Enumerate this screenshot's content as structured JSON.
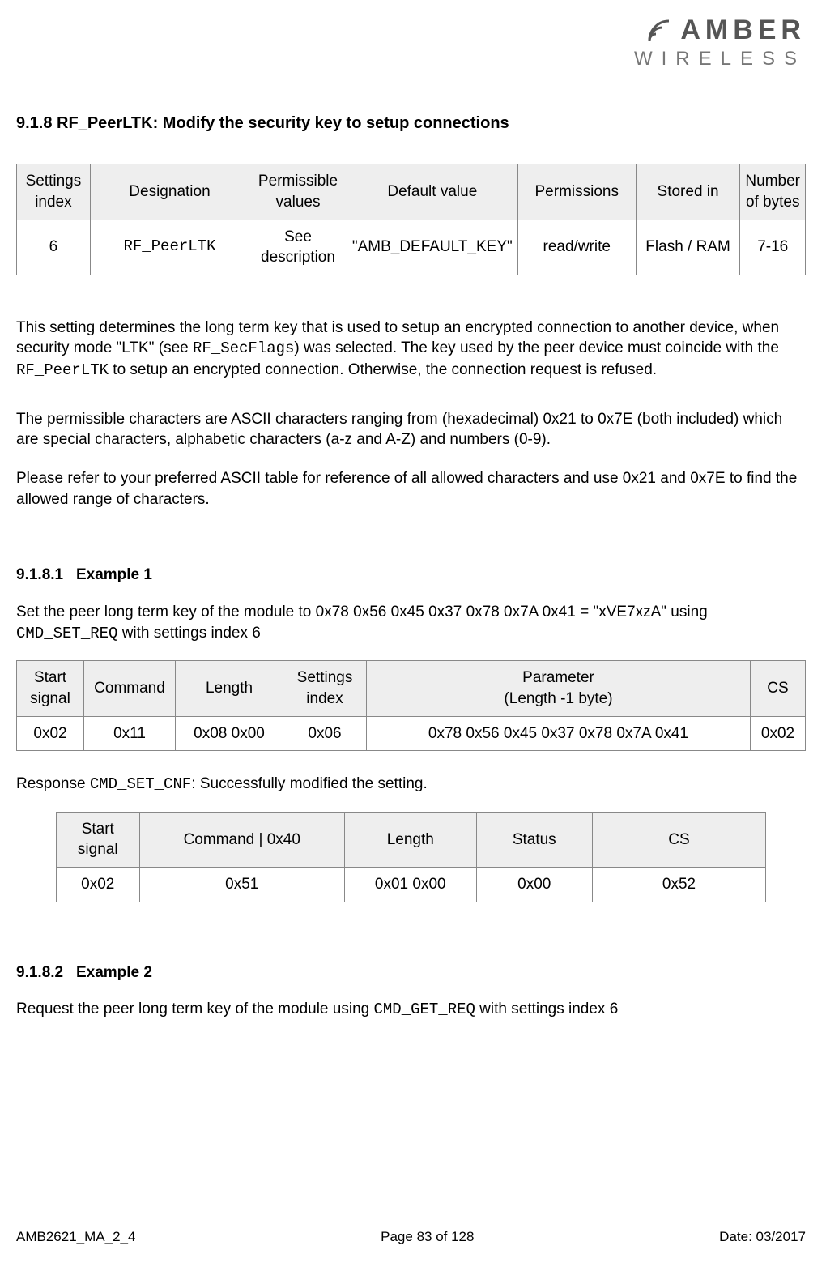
{
  "logo": {
    "line1": "AMBER",
    "line2": "WIRELESS"
  },
  "section": {
    "number": "9.1.8",
    "title": "RF_PeerLTK: Modify the security key to setup connections"
  },
  "settings_table": {
    "headers": [
      "Settings index",
      "Designation",
      "Permissible values",
      "Default value",
      "Permissions",
      "Stored in",
      "Number of bytes"
    ],
    "row": [
      "6",
      "RF_PeerLTK",
      "See description",
      "\"AMB_DEFAULT_KEY\"",
      "read/write",
      "Flash / RAM",
      "7-16"
    ]
  },
  "para1a": "This setting determines the long term key that is used to setup an encrypted connection to another device, when security mode \"LTK\" (see ",
  "para1_code1": "RF_SecFlags",
  "para1b": ") was selected. The key used by the peer device must coincide with the ",
  "para1_code2": "RF_PeerLTK",
  "para1c": " to setup an encrypted connection. Otherwise, the connection request is refused.",
  "para2": "The permissible characters are ASCII characters ranging from (hexadecimal) 0x21 to 0x7E (both included) which are special characters, alphabetic characters (a-z and A-Z) and numbers (0-9).",
  "para3": "Please refer to your preferred ASCII table for reference of all allowed characters and use 0x21 and 0x7E to find the allowed range of characters.",
  "example1": {
    "number": "9.1.8.1",
    "title": "Example 1",
    "intro_a": "Set the peer long term key of the module to 0x78 0x56 0x45 0x37 0x78 0x7A 0x41 = \"xVE7xzA\" using ",
    "intro_code": " CMD_SET_REQ",
    "intro_b": " with settings index 6",
    "table1": {
      "headers": [
        "Start signal",
        "Command",
        "Length",
        "Settings index",
        "Parameter\n(Length -1 byte)",
        "CS"
      ],
      "row": [
        "0x02",
        "0x11",
        "0x08 0x00",
        "0x06",
        "0x78 0x56 0x45 0x37 0x78 0x7A 0x41",
        "0x02"
      ]
    },
    "resp_a": "Response ",
    "resp_code": "CMD_SET_CNF",
    "resp_b": ": Successfully modified the setting.",
    "table2": {
      "headers": [
        "Start signal",
        "Command | 0x40",
        "Length",
        "Status",
        "CS"
      ],
      "row": [
        "0x02",
        "0x51",
        "0x01 0x00",
        "0x00",
        "0x52"
      ]
    }
  },
  "example2": {
    "number": "9.1.8.2",
    "title": "Example 2",
    "intro_a": "Request the peer long term key of the module using ",
    "intro_code": " CMD_GET_REQ",
    "intro_b": " with settings index 6"
  },
  "footer": {
    "left": "AMB2621_MA_2_4",
    "center": "Page 83 of 128",
    "right": "Date: 03/2017"
  }
}
